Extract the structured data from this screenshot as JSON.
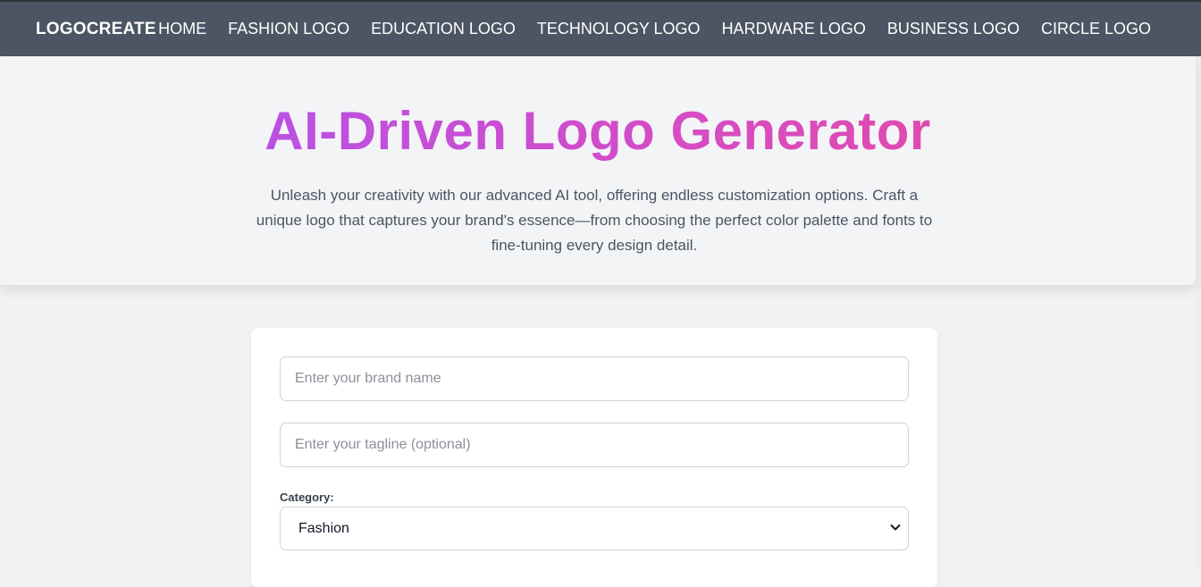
{
  "nav": {
    "brand": "LOGOCREATE",
    "links": [
      {
        "label": "HOME"
      },
      {
        "label": "FASHION LOGO"
      },
      {
        "label": "EDUCATION LOGO"
      },
      {
        "label": "TECHNOLOGY LOGO"
      },
      {
        "label": "HARDWARE LOGO"
      },
      {
        "label": "BUSINESS LOGO"
      },
      {
        "label": "CIRCLE LOGO"
      }
    ]
  },
  "hero": {
    "title": "AI-Driven Logo Generator",
    "subtitle": "Unleash your creativity with our advanced AI tool, offering endless customization options. Craft a unique logo that captures your brand's essence—from choosing the perfect color palette and fonts to fine-tuning every design detail."
  },
  "form": {
    "brand_name": {
      "value": "",
      "placeholder": "Enter your brand name"
    },
    "tagline": {
      "value": "",
      "placeholder": "Enter your tagline (optional)"
    },
    "category": {
      "label": "Category:",
      "selected": "Fashion"
    }
  },
  "colors": {
    "navbar": "#4b5563",
    "hero_bg": "#f3f4f6",
    "title_gradient_start": "#a855f7",
    "title_gradient_end": "#ec4899"
  },
  "icons": {
    "select_chevron": "chevron-down-icon"
  }
}
